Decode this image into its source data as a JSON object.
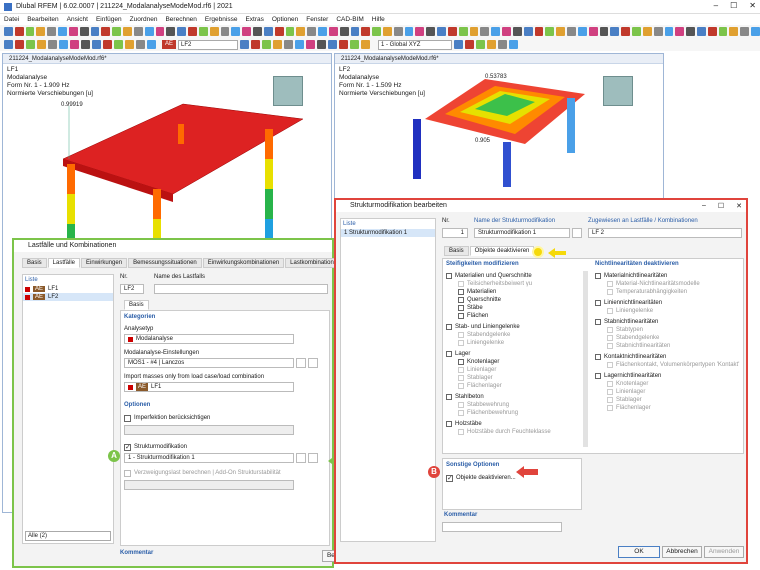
{
  "app": {
    "title": "Dlubal RFEM | 6.02.0007 | 211224_ModalanalyseModeMod.rf6 | 2021"
  },
  "menu": [
    "Datei",
    "Bearbeiten",
    "Ansicht",
    "Einfügen",
    "Zuordnen",
    "Berechnen",
    "Ergebnisse",
    "Extras",
    "Optionen",
    "Fenster",
    "CAD-BIM",
    "Hilfe"
  ],
  "toolbar": {
    "lc_badge": "AE",
    "lc_name": "LF2",
    "coord_system": "1 - Global XYZ"
  },
  "view_left": {
    "tab": "211224_ModalanalyseModeMod.rf6*",
    "lines": [
      "LF1",
      "Modalanalyse",
      "Form Nr. 1 - 1.909 Hz",
      "Normierte Verschiebungen [u]"
    ],
    "val1": "0.99919"
  },
  "view_right": {
    "tab": "211224_ModalanalyseModeMod.rf6*",
    "lines": [
      "LF2",
      "Modalanalyse",
      "Form Nr. 1 - 1.509 Hz",
      "Normierte Verschiebungen [u]"
    ],
    "val1": "0.53783",
    "val2": "0.905"
  },
  "dlg_lc": {
    "title": "Lastfälle und Kombinationen",
    "tabs": [
      "Basis",
      "Lastfälle",
      "Einwirkungen",
      "Bemessungssituationen",
      "Einwirkungskombinationen",
      "Lastkombinationen"
    ],
    "list_header": "Liste",
    "list": [
      {
        "badge": "AE",
        "name": "LF1"
      },
      {
        "badge": "AE",
        "name": "LF2"
      }
    ],
    "nr_label": "Nr.",
    "nr_value": "LF2",
    "name_label": "Name des Lastfalls",
    "subtab": "Basis",
    "kategorien": "Kategorien",
    "analysetyp_label": "Analysetyp",
    "analysetyp_value": "Modalanalyse",
    "modal_label": "Modalanalyse-Einstellungen",
    "modal_value": "MOS1 - #4 | Lanczos",
    "import_label": "Import masses only from load case/load combination",
    "import_badge": "AE",
    "import_value": "LF1",
    "optionen": "Optionen",
    "imperfektion": "Imperfektion berücksichtigen",
    "strukturmod": "Strukturmodifikation",
    "strukturmod_value": "1 - Strukturmodifikation 1",
    "verzweigung": "Verzweigungslast berechnen | Add-On Strukturstabilität",
    "kommentar": "Kommentar",
    "filter": "Alle (2)",
    "cut_button": "Ber"
  },
  "dlg_sm": {
    "title": "Strukturmodifikation bearbeiten",
    "list_header": "Liste",
    "list_item": "1  Strukturmodifikation 1",
    "nr_label": "Nr.",
    "nr_value": "1",
    "name_label": "Name der Strukturmodifikation",
    "name_value": "Strukturmodifikation 1",
    "assign_label": "Zugewiesen an Lastfälle / Kombinationen",
    "assign_value": "LF 2",
    "tabs": [
      "Basis",
      "Objekte deaktivieren"
    ],
    "steif_head": "Steifigkeiten modifizieren",
    "nl_head": "Nichtlinearitäten deaktivieren",
    "left_groups": [
      {
        "title": "Materialien und Querschnitte",
        "items": [
          {
            "t": "Teilsicherheitsbeiwert γu",
            "g": true,
            "c": false
          },
          {
            "t": "Materialien",
            "g": false,
            "c": true
          },
          {
            "t": "Querschnitte",
            "g": false,
            "c": true
          },
          {
            "t": "Stäbe",
            "g": false,
            "c": true
          },
          {
            "t": "Flächen",
            "g": false,
            "c": true
          }
        ]
      },
      {
        "title": "Stab- und Liniengelenke",
        "items": [
          {
            "t": "Stabendgelenke",
            "g": true,
            "c": false
          },
          {
            "t": "Liniengelenke",
            "g": true,
            "c": false
          }
        ]
      },
      {
        "title": "Lager",
        "items": [
          {
            "t": "Knotenlager",
            "g": false,
            "c": true
          },
          {
            "t": "Linienlager",
            "g": true,
            "c": false
          },
          {
            "t": "Stablager",
            "g": true,
            "c": false
          },
          {
            "t": "Flächenlager",
            "g": true,
            "c": false
          }
        ]
      },
      {
        "title": "Stahlbeton",
        "items": [
          {
            "t": "Stabbewehrung",
            "g": true,
            "c": false
          },
          {
            "t": "Flächenbewehrung",
            "g": true,
            "c": false
          }
        ]
      },
      {
        "title": "Holzstäbe",
        "items": [
          {
            "t": "Holzstäbe durch Feuchteklasse",
            "g": true,
            "c": false
          }
        ]
      }
    ],
    "right_groups": [
      {
        "title": "Materialnichtlinearitäten",
        "items": [
          "Material-Nichtlinearitätsmodelle",
          "Temperaturabhängigkeiten"
        ]
      },
      {
        "title": "Liniennichtlinearitäten",
        "items": [
          "Liniengelenke"
        ]
      },
      {
        "title": "Stabnichtlinearitäten",
        "items": [
          "Stabtypen",
          "Stabendgelenke",
          "Stabnichtlinearitäten"
        ]
      },
      {
        "title": "Kontaktnichtlinearitäten",
        "items": [
          "Flächenkontakt, Volumenkörpertypen 'Kontakt'"
        ]
      },
      {
        "title": "Lagernichtlinearitäten",
        "items": [
          "Knotenlager",
          "Linienlager",
          "Stablager",
          "Flächenlager"
        ]
      }
    ],
    "sonstige": "Sonstige Optionen",
    "objekte": "Objekte deaktivieren...",
    "kommentar": "Kommentar",
    "ok": "OK",
    "cancel": "Abbrechen",
    "apply": "Anwenden"
  },
  "markers": {
    "a": "A",
    "b": "B"
  },
  "colors": {
    "green_frame": "#7cc44a",
    "red_frame": "#e0443c",
    "yellow_marker": "#f5d90a"
  }
}
